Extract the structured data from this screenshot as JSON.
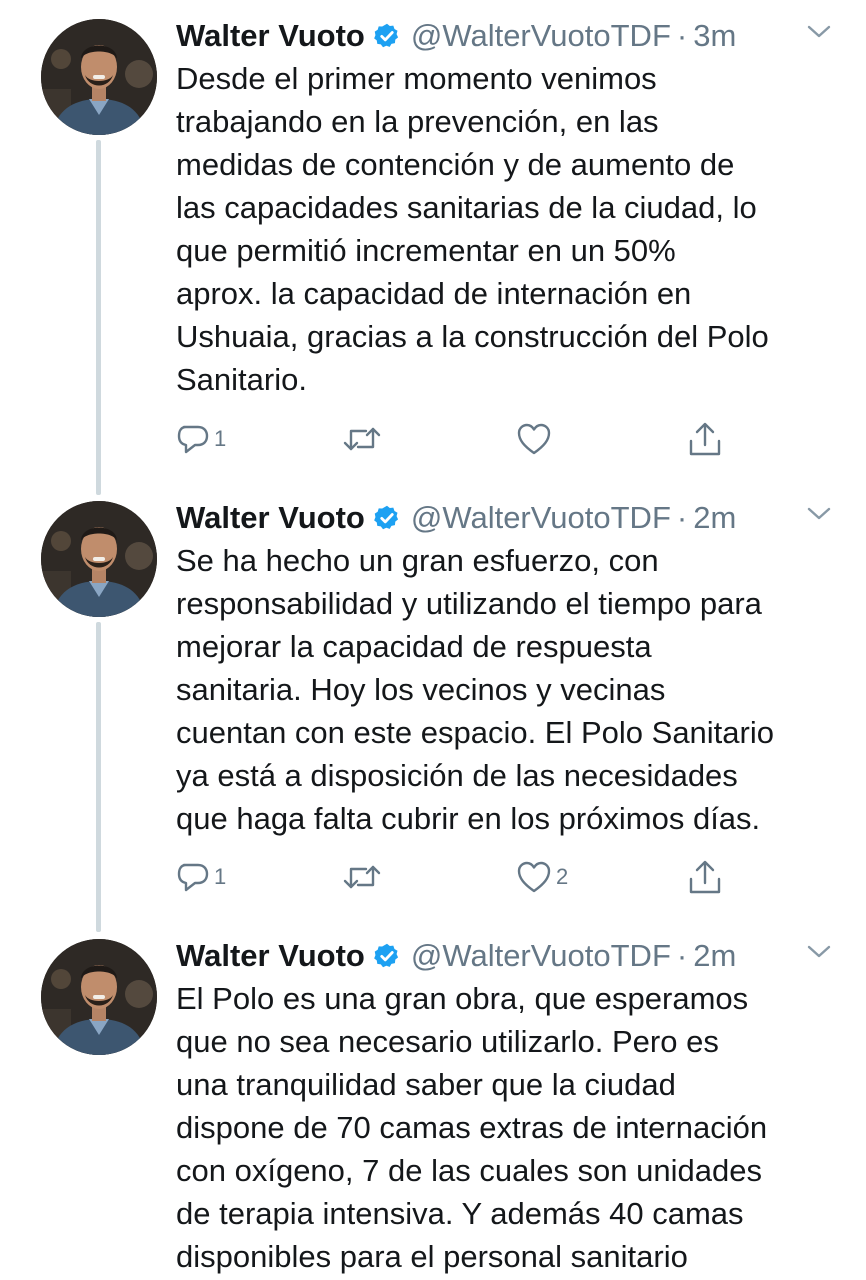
{
  "tweets": [
    {
      "name": "Walter Vuoto",
      "handle": "@WalterVuotoTDF",
      "separator": "·",
      "time": "3m",
      "text": "Desde el primer momento venimos\ntrabajando en la prevención, en las\nmedidas de contención y de aumento de\nlas capacidades sanitarias de la ciudad, lo\nque permitió incrementar en un 50%\naprox. la capacidad de internación en\nUshuaia, gracias a la construcción del Polo\nSanitario.",
      "reply_count": "1",
      "retweet_count": "",
      "like_count": ""
    },
    {
      "name": "Walter Vuoto",
      "handle": "@WalterVuotoTDF",
      "separator": "·",
      "time": "2m",
      "text": "Se ha hecho un gran esfuerzo, con\nresponsabilidad y utilizando el tiempo para\nmejorar la capacidad de respuesta\nsanitaria. Hoy los vecinos y vecinas\ncuentan con este espacio. El Polo Sanitario\nya está a disposición de las necesidades\nque haga falta cubrir en los próximos días.",
      "reply_count": "1",
      "retweet_count": "",
      "like_count": "2"
    },
    {
      "name": "Walter Vuoto",
      "handle": "@WalterVuotoTDF",
      "separator": "·",
      "time": "2m",
      "text": "El Polo es una gran obra, que esperamos\nque no sea necesario utilizarlo. Pero es\nuna tranquilidad saber que la ciudad\ndispone de 70 camas extras de internación\ncon oxígeno, 7 de las cuales son unidades\nde terapia intensiva. Y además 40 camas\ndisponibles para el personal sanitario"
    }
  ],
  "icons": {
    "verified": "verified-badge-icon",
    "caret": "chevron-down-icon",
    "reply": "reply-icon",
    "retweet": "retweet-icon",
    "like": "heart-icon",
    "share": "share-icon"
  },
  "colors": {
    "text": "#14171a",
    "secondary": "#657786",
    "verified": "#1da1f2",
    "thread_line": "#cfd9de"
  }
}
